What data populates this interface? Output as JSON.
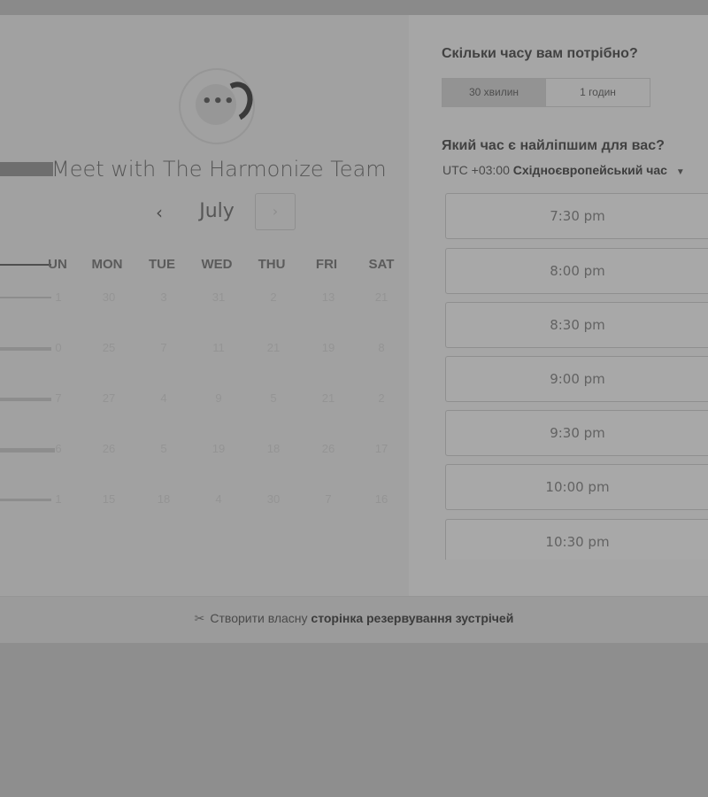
{
  "header": {
    "title": "Meet with The Harmonize Team",
    "month": "July",
    "prev_icon": "‹",
    "next_icon": "›"
  },
  "calendar": {
    "weekdays": [
      "UN",
      "MON",
      "TUE",
      "WED",
      "THU",
      "FRI",
      "SAT"
    ],
    "rows": [
      [
        "1",
        "30",
        "3",
        "31",
        "2",
        "13",
        "21"
      ],
      [
        "0",
        "25",
        "7",
        "11",
        "21",
        "19",
        "8"
      ],
      [
        "7",
        "27",
        "4",
        "9",
        "5",
        "21",
        "2"
      ],
      [
        "6",
        "26",
        "5",
        "19",
        "18",
        "26",
        "17"
      ],
      [
        "1",
        "15",
        "18",
        "4",
        "30",
        "7",
        "16"
      ]
    ]
  },
  "duration": {
    "question": "Скільки часу вам потрібно?",
    "options": [
      "30 хвилин",
      "1 годин"
    ],
    "selected": "30 хвилин"
  },
  "time_picker": {
    "question": "Який час є найліпшим для вас?",
    "timezone_offset": "UTC +03:00",
    "timezone_name": "Східноєвропейський час",
    "slots": [
      "7:30 pm",
      "8:00 pm",
      "8:30 pm",
      "9:00 pm",
      "9:30 pm",
      "10:00 pm",
      "10:30 pm"
    ]
  },
  "footer": {
    "prefix": "Створити власну",
    "link": "сторінка резервування зустрічей"
  },
  "icons": {
    "logo": "chat-bubble-logo-icon",
    "caret": "caret-down-icon",
    "footer": "scissors-icon"
  }
}
